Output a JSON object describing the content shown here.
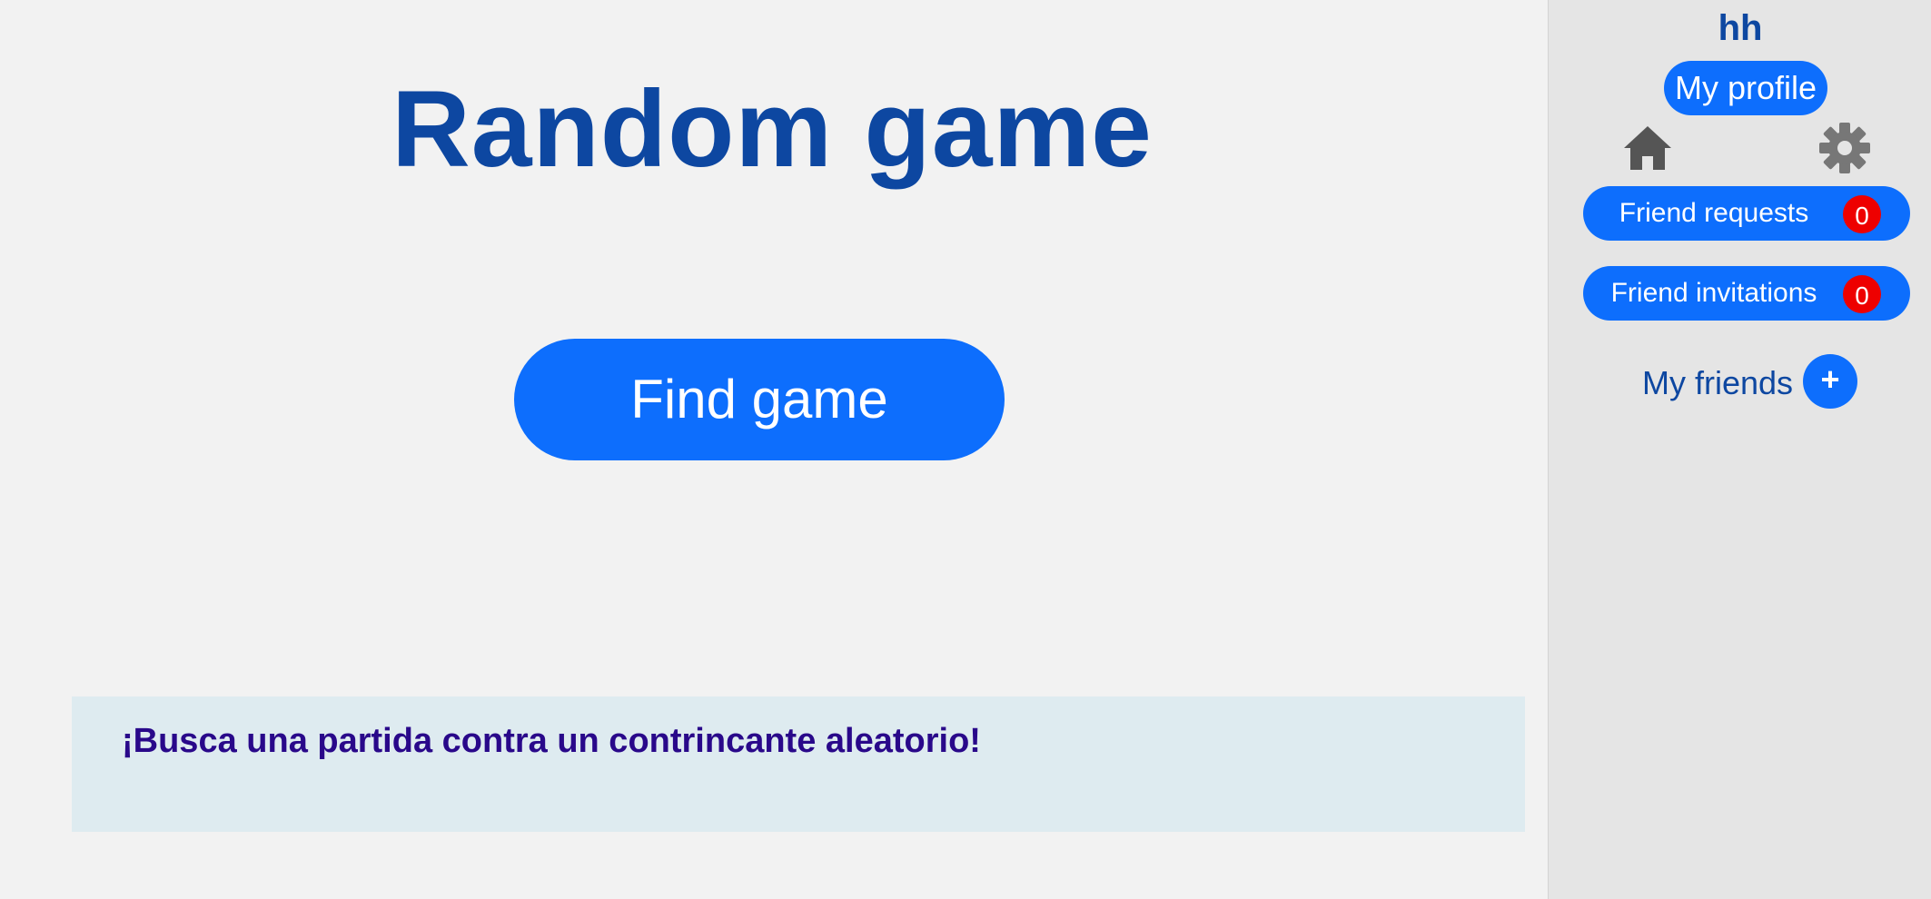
{
  "main": {
    "title": "Random game",
    "find_game_label": "Find game",
    "info_text": "¡Busca una partida contra un contrincante aleatorio!"
  },
  "sidebar": {
    "username": "hh",
    "profile_label": "My profile",
    "home_icon": "home-icon",
    "settings_icon": "gear-icon",
    "friend_requests": {
      "label": "Friend requests",
      "count": "0"
    },
    "friend_invitations": {
      "label": "Friend invitations",
      "count": "0"
    },
    "my_friends_label": "My friends",
    "add_friend_label": "+"
  },
  "colors": {
    "accent": "#0d6efd",
    "title": "#0d47a1",
    "badge": "#ee0000",
    "info_bg": "#deebf0",
    "info_text": "#29088a",
    "sidebar_bg": "#e5e5e5",
    "page_bg": "#f2f2f2"
  }
}
